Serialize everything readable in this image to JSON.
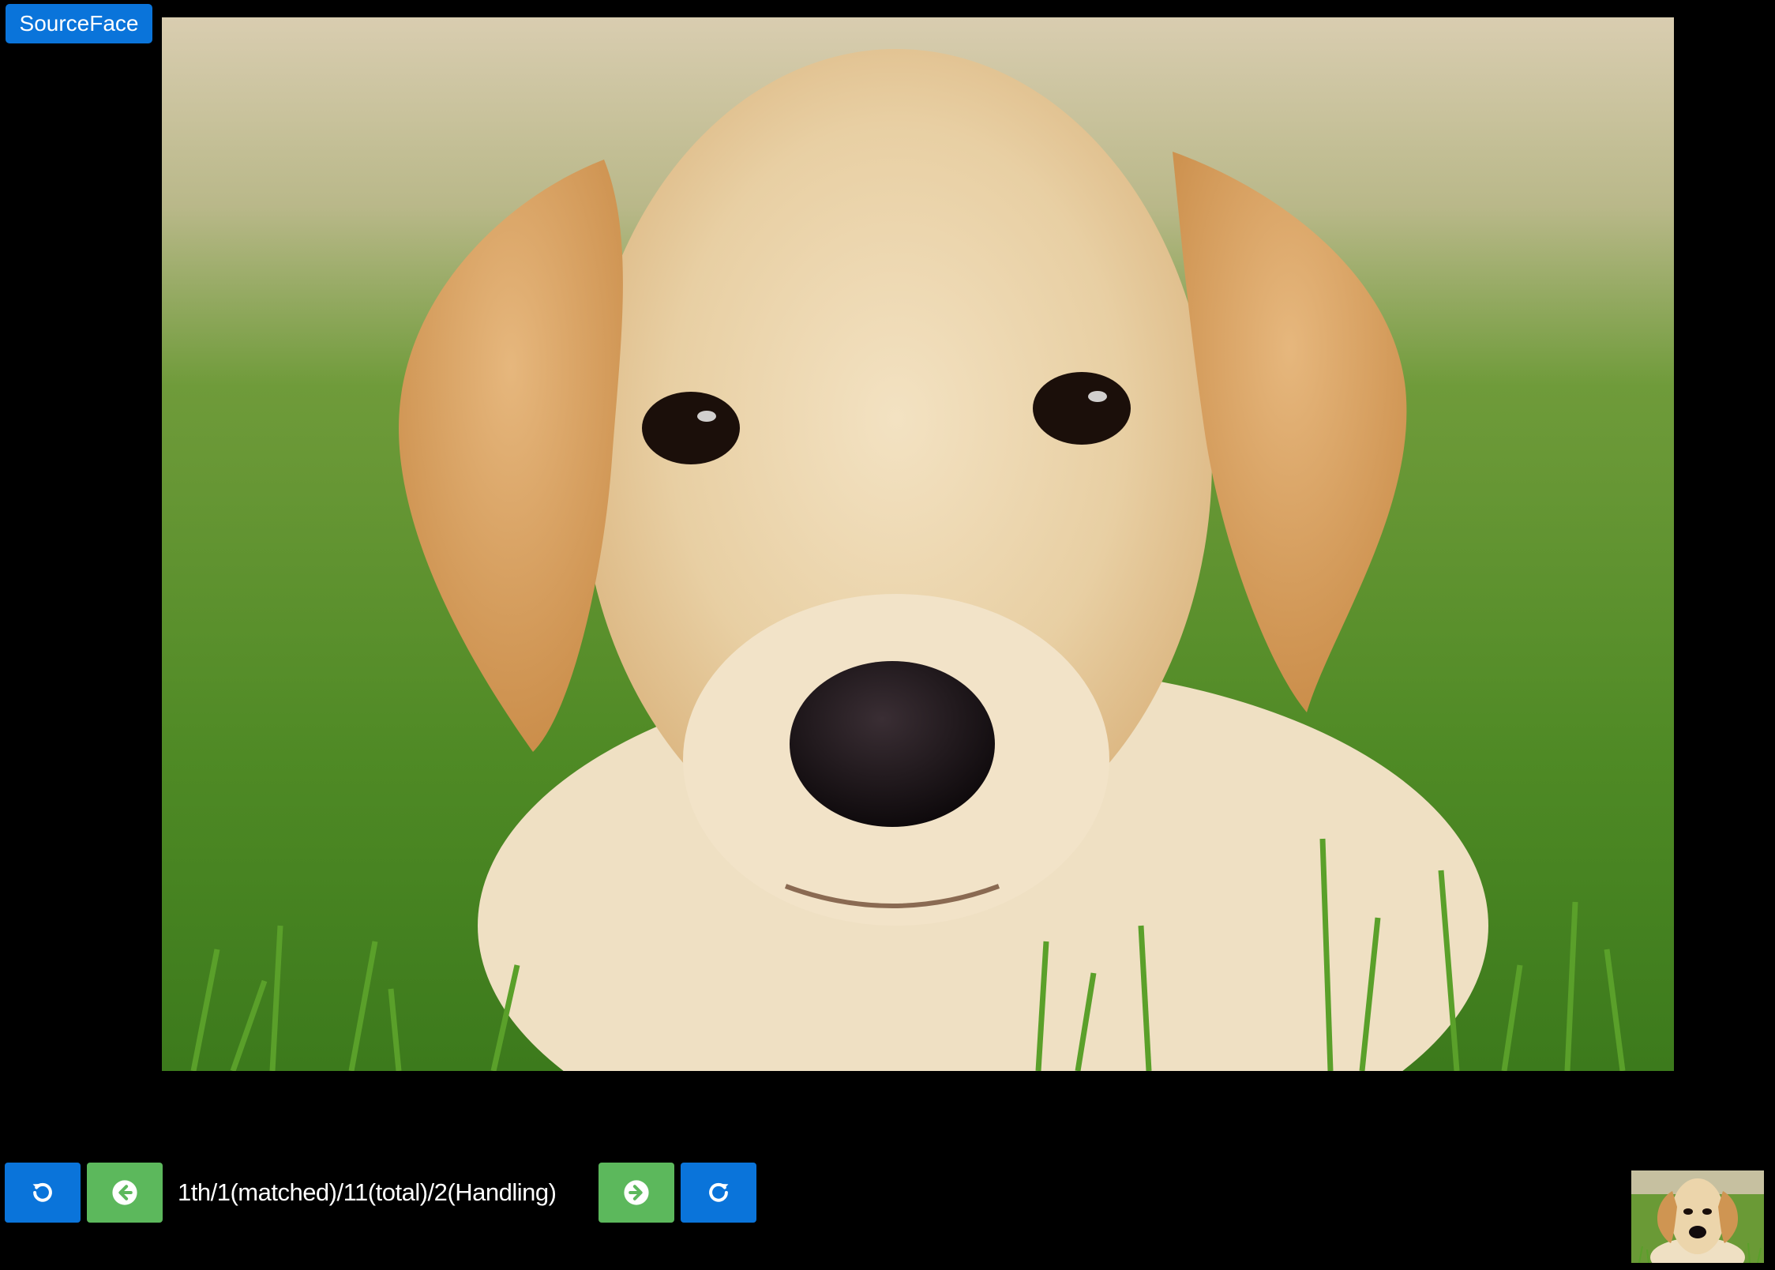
{
  "source_button": {
    "label": "SourceFace"
  },
  "main_image": {
    "subject": "labrador-puppy-photo"
  },
  "controls": {
    "rotate_left": {
      "icon": "rotate-left-icon"
    },
    "prev": {
      "icon": "arrow-left-circle-icon"
    },
    "status": "1th/1(matched)/11(total)/2(Handling)",
    "next": {
      "icon": "arrow-right-circle-icon"
    },
    "rotate_right": {
      "icon": "rotate-right-icon"
    }
  },
  "thumbnail": {
    "subject": "labrador-puppy-thumbnail"
  },
  "colors": {
    "primary_blue": "#0a74da",
    "success_green": "#5cb85c",
    "background": "#000000"
  }
}
